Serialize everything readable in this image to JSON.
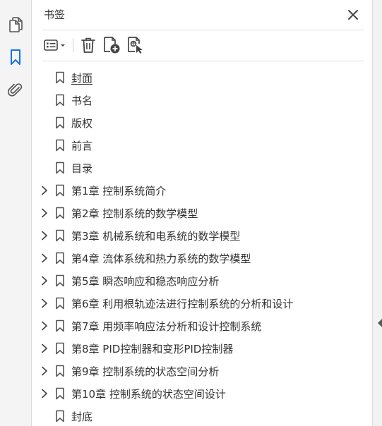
{
  "panel": {
    "title": "书签"
  },
  "rail": {
    "icons": [
      "pages-icon",
      "bookmark-icon",
      "attachment-icon"
    ],
    "active_color": "#1473e6"
  },
  "toolbar": {
    "options_icon": "options-list-icon",
    "delete_icon": "trash-icon",
    "new_bookmark_icon": "new-bookmark-icon",
    "find_bookmark_icon": "find-bookmark-icon"
  },
  "bookmarks": [
    {
      "label": "封面",
      "expandable": false
    },
    {
      "label": "书名",
      "expandable": false
    },
    {
      "label": "版权",
      "expandable": false
    },
    {
      "label": "前言",
      "expandable": false
    },
    {
      "label": "目录",
      "expandable": false
    },
    {
      "label": "第1章  控制系统简介",
      "expandable": true
    },
    {
      "label": "第2章  控制系统的数学模型",
      "expandable": true
    },
    {
      "label": "第3章  机械系统和电系统的数学模型",
      "expandable": true
    },
    {
      "label": "第4章  流体系统和热力系统的数学模型",
      "expandable": true
    },
    {
      "label": "第5章  瞬态响应和稳态响应分析",
      "expandable": true
    },
    {
      "label": "第6章  利用根轨迹法进行控制系统的分析和设计",
      "expandable": true
    },
    {
      "label": "第7章  用频率响应法分析和设计控制系统",
      "expandable": true
    },
    {
      "label": "第8章  PID控制器和变形PID控制器",
      "expandable": true
    },
    {
      "label": "第9章  控制系统的状态空间分析",
      "expandable": true
    },
    {
      "label": "第10章  控制系统的状态空间设计",
      "expandable": true
    },
    {
      "label": "封底",
      "expandable": false
    }
  ]
}
